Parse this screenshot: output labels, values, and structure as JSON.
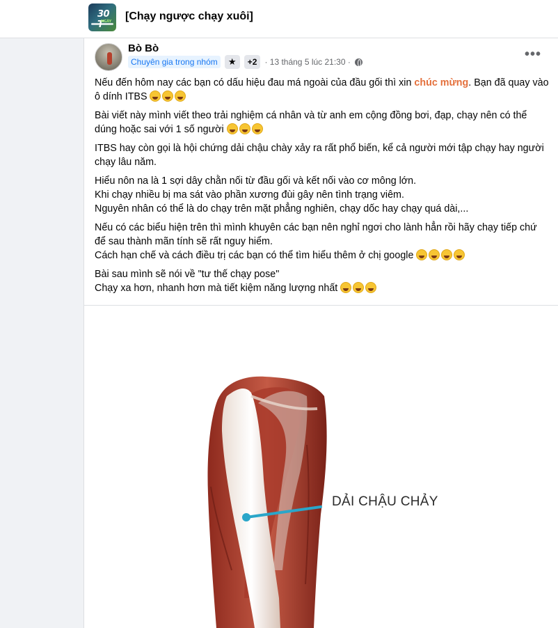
{
  "group": {
    "title": "[Chạy ngược chạy xuôi]",
    "thumb_text": "30 T",
    "thumb_sub": "NGÀY"
  },
  "post": {
    "author": "Bò Bò",
    "badge": "Chuyên gia trong nhóm",
    "star_icon": "★",
    "plus": "+2",
    "timestamp": "· 13 tháng 5 lúc 21:30 ·",
    "more": "•••",
    "paragraphs": {
      "p1_pre": "Nếu đến hôm nay các bạn có dấu hiệu đau má ngoài của đầu gối thì xin ",
      "p1_hl": "chúc mừng",
      "p1_post": ". Bạn đã quay vào ô dính ITBS ",
      "p2": "Bài viết này mình viết theo trải nghiệm cá nhân và từ anh em cộng đồng bơi, đạp, chạy nên có thể dúng hoặc sai với 1 số người ",
      "p3": "ITBS hay còn gọi là hội chứng dải chậu chày xảy ra rất phổ biến, kể cả người mới tập chạy hay người chạy lâu năm.",
      "p4_l1": "Hiểu nôn na là 1 sợi dây chằn nối từ đầu gối và kết nối vào cơ mông lớn.",
      "p4_l2": "Khi chạy nhiều bị ma sát vào phần xương đùi gây nên tình trạng viêm.",
      "p4_l3": "Nguyên nhân có thể là do chạy trên mặt phẳng nghiên, chạy dốc hay chạy quá dài,...",
      "p5_l1": "Nếu có các biểu hiện trên thì mình khuyên các bạn nên nghỉ ngơi cho lành hẳn rồi hãy chạy tiếp chứ để sau thành mãn tính sẽ rất nguy hiểm.",
      "p5_l2": "Cách hạn chế và cách điều trị các bạn có thể tìm hiểu thêm ở chị google ",
      "p6_l1": "Bài sau mình sẽ nói về \"tư thế chạy pose\"",
      "p6_l2": "Chạy xa hơn, nhanh hơn mà tiết kiệm năng lượng nhất "
    },
    "image_label": "DẢI CHẬU CHẢY"
  }
}
